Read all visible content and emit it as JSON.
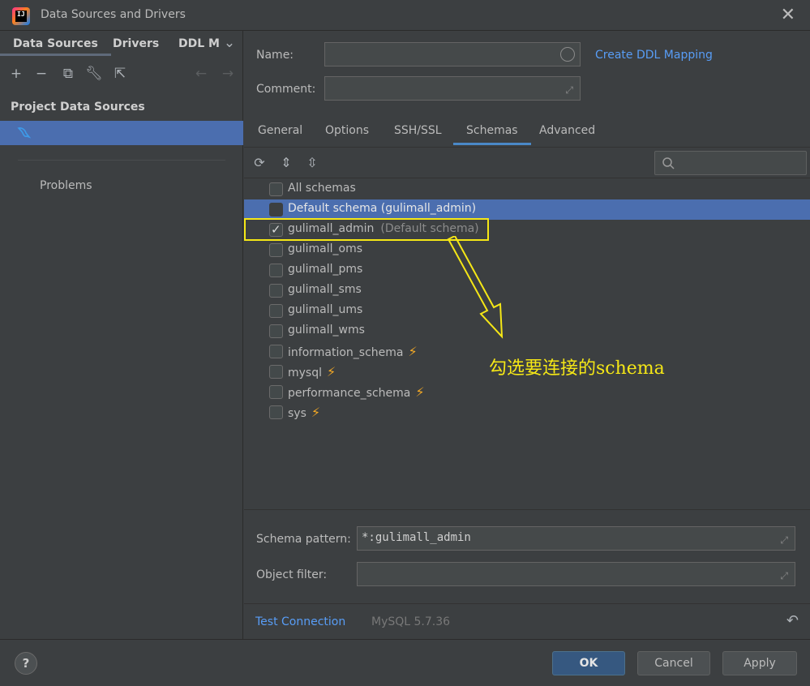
{
  "window": {
    "title": "Data Sources and Drivers"
  },
  "left": {
    "tabs": [
      "Data Sources",
      "Drivers",
      "DDL M"
    ],
    "section_title": "Project Data Sources",
    "problems_label": "Problems"
  },
  "form": {
    "name_label": "Name:",
    "name_value": "",
    "comment_label": "Comment:",
    "comment_value": "",
    "create_ddl_link": "Create DDL Mapping"
  },
  "tabs": [
    "General",
    "Options",
    "SSH/SSL",
    "Schemas",
    "Advanced"
  ],
  "active_tab": "Schemas",
  "schemas": [
    {
      "name": "All schemas",
      "hint": "",
      "checked": false,
      "selected": false,
      "bolt": false
    },
    {
      "name": "Default schema (gulimall_admin)",
      "hint": "",
      "checked": false,
      "selected": true,
      "bolt": false
    },
    {
      "name": "gulimall_admin",
      "hint": "(Default schema)",
      "checked": true,
      "selected": false,
      "bolt": false
    },
    {
      "name": "gulimall_oms",
      "hint": "",
      "checked": false,
      "selected": false,
      "bolt": false
    },
    {
      "name": "gulimall_pms",
      "hint": "",
      "checked": false,
      "selected": false,
      "bolt": false
    },
    {
      "name": "gulimall_sms",
      "hint": "",
      "checked": false,
      "selected": false,
      "bolt": false
    },
    {
      "name": "gulimall_ums",
      "hint": "",
      "checked": false,
      "selected": false,
      "bolt": false
    },
    {
      "name": "gulimall_wms",
      "hint": "",
      "checked": false,
      "selected": false,
      "bolt": false
    },
    {
      "name": "information_schema",
      "hint": "",
      "checked": false,
      "selected": false,
      "bolt": true
    },
    {
      "name": "mysql",
      "hint": "",
      "checked": false,
      "selected": false,
      "bolt": true
    },
    {
      "name": "performance_schema",
      "hint": "",
      "checked": false,
      "selected": false,
      "bolt": true
    },
    {
      "name": "sys",
      "hint": "",
      "checked": false,
      "selected": false,
      "bolt": true
    }
  ],
  "annotation": "勾选要连接的schema",
  "filters": {
    "schema_pattern_label": "Schema pattern:",
    "schema_pattern_value": "*:gulimall_admin",
    "object_filter_label": "Object filter:",
    "object_filter_value": ""
  },
  "status": {
    "test_connection": "Test Connection",
    "version": "MySQL 5.7.36"
  },
  "buttons": {
    "ok": "OK",
    "cancel": "Cancel",
    "apply": "Apply",
    "help": "?"
  },
  "colors": {
    "accent": "#4b6eaf",
    "link": "#589df6",
    "annotation": "#f5e716",
    "bolt": "#f4a925"
  }
}
